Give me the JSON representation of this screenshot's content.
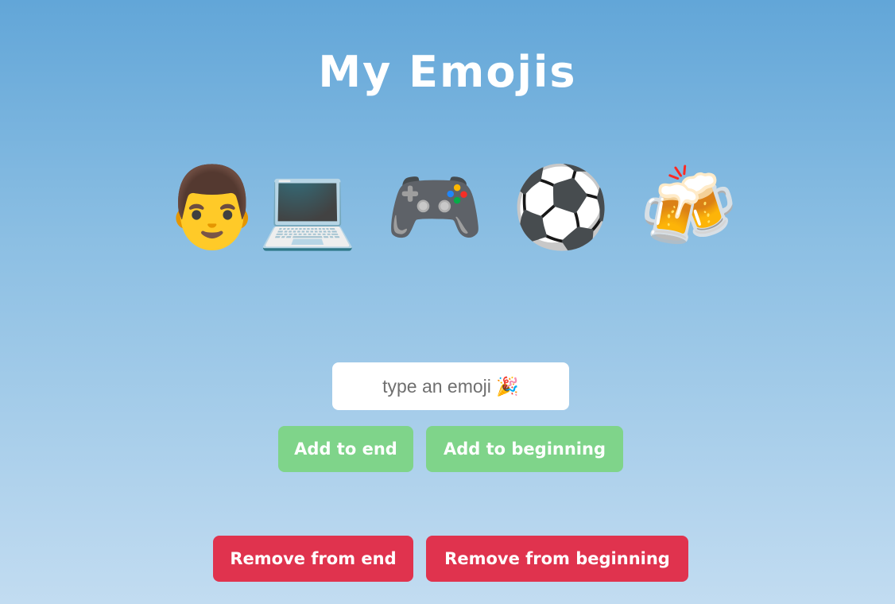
{
  "header": {
    "title": "My Emojis"
  },
  "emojis": [
    {
      "glyph": "👨",
      "name": "man"
    },
    {
      "glyph": "💻",
      "name": "laptop"
    },
    {
      "glyph": "🎮",
      "name": "video-game-controller"
    },
    {
      "glyph": "⚽",
      "name": "soccer-ball"
    },
    {
      "glyph": "🍻",
      "name": "clinking-beer-mugs"
    }
  ],
  "input": {
    "value": "",
    "placeholder": "type an emoji 🎉"
  },
  "actions": {
    "add_end_label": "Add to end",
    "add_beginning_label": "Add to beginning",
    "remove_end_label": "Remove from end",
    "remove_beginning_label": "Remove from beginning"
  },
  "colors": {
    "background_top": "#62a6d8",
    "background_bottom": "#c2dcf1",
    "add_button": "#7fd48a",
    "remove_button": "#e0334e",
    "text": "#ffffff"
  }
}
